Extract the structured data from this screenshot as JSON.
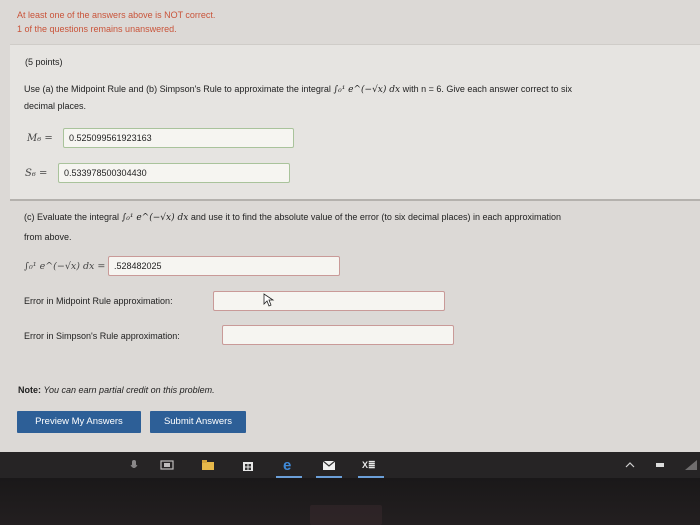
{
  "status": {
    "incorrect": "At least one of the answers above is NOT correct.",
    "unanswered": "1 of the questions remains unanswered."
  },
  "problem": {
    "points": "(5 points)",
    "statement_line1": "Use (a) the Midpoint Rule and (b) Simpson's Rule to approximate the integral",
    "integral": "∫₀¹ e^(−√x) dx",
    "statement_with_n": "with n = 6. Give each answer correct to six",
    "statement_line2": "decimal places."
  },
  "part_ab": {
    "m6_label": "M₆ =",
    "m6_value": "0.525099561923163",
    "s6_label": "S₆ =",
    "s6_value": "0.533978500304430"
  },
  "part_c": {
    "text_start": "(c) Evaluate the integral",
    "text_end": "and use it to find the absolute value of the error (to six decimal places) in each approximation",
    "text_line2": "from above.",
    "integral_label": "∫₀¹ e^(−√x) dx =",
    "integral_value": ".528482025",
    "midpoint_error_label": "Error in Midpoint Rule approximation:",
    "midpoint_error_value": "",
    "simpson_error_label": "Error in Simpson's Rule approximation:",
    "simpson_error_value": ""
  },
  "note": {
    "bold": "Note:",
    "text": "You can earn partial credit on this problem."
  },
  "buttons": {
    "preview": "Preview My Answers",
    "submit": "Submit Answers"
  },
  "taskbar": {
    "excel_label": "X≣"
  },
  "colors": {
    "accent_button": "#2d5f97",
    "error_text": "#c9543a",
    "correct_border": "#a9c39b",
    "empty_border": "#c99a98"
  }
}
